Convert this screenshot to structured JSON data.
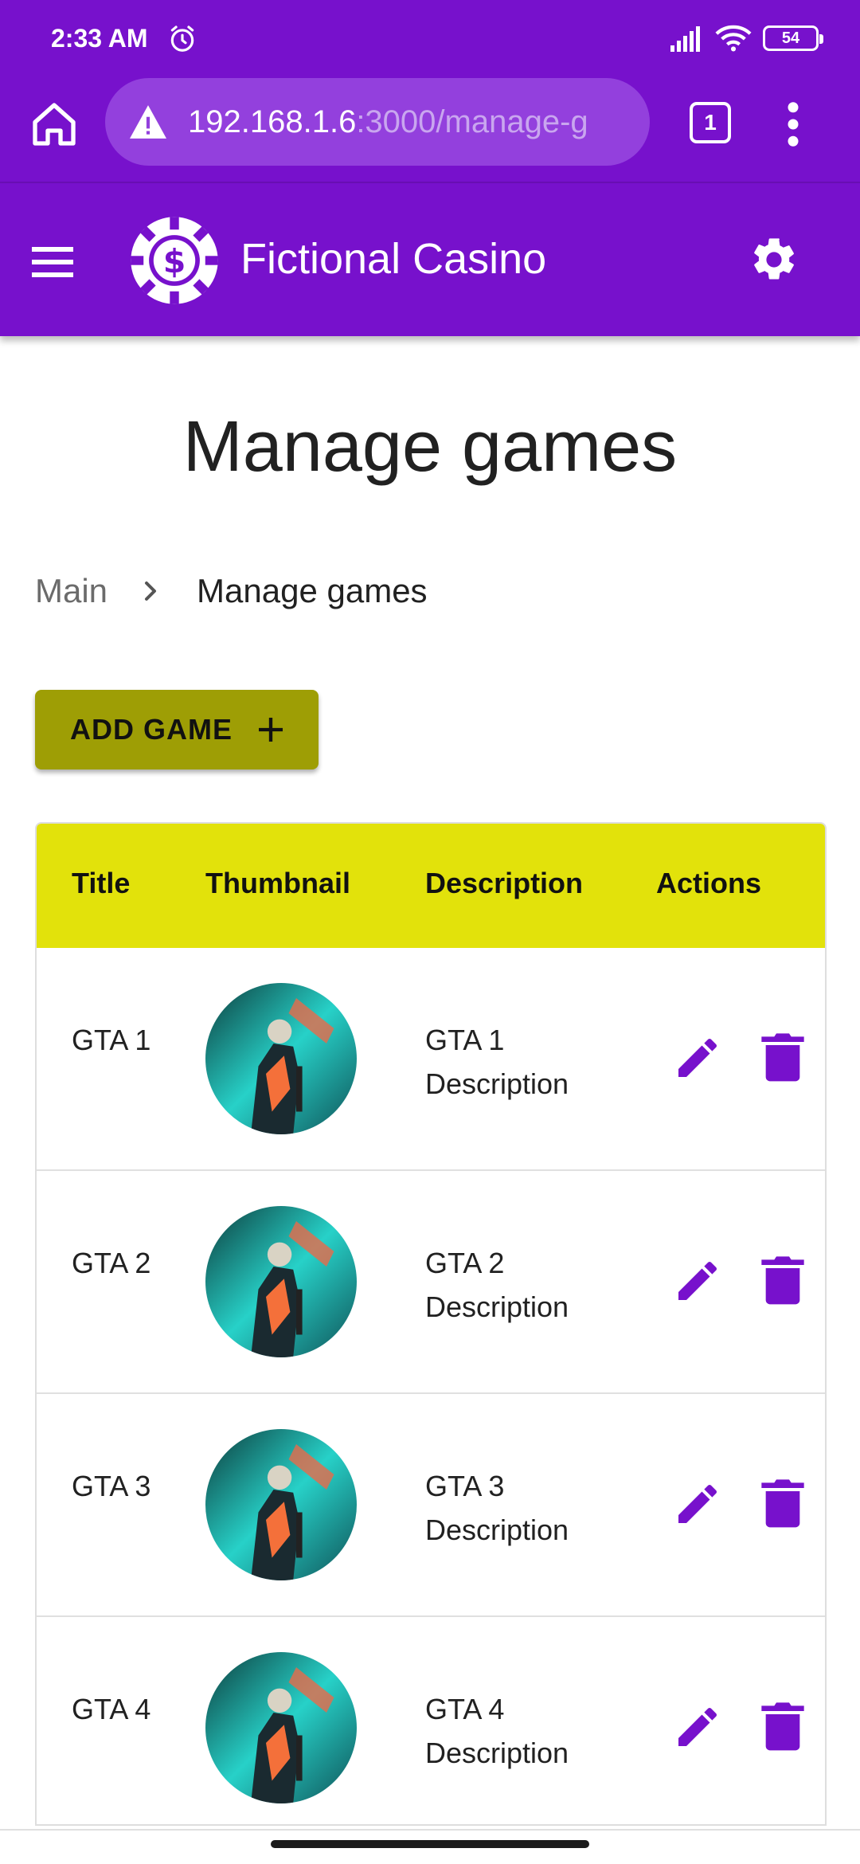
{
  "status_bar": {
    "time": "2:33 AM",
    "battery": "54"
  },
  "browser": {
    "url_host": "192.168.1.6",
    "url_path": ":3000/manage-g",
    "tab_count": "1"
  },
  "app_bar": {
    "title": "Fictional Casino"
  },
  "page": {
    "title": "Manage games",
    "breadcrumb": {
      "main": "Main",
      "current": "Manage games"
    },
    "add_button_label": "ADD GAME"
  },
  "table": {
    "headers": {
      "title": "Title",
      "thumbnail": "Thumbnail",
      "description": "Description",
      "actions": "Actions"
    },
    "rows": [
      {
        "title": "GTA 1",
        "description": "GTA 1 Description"
      },
      {
        "title": "GTA 2",
        "description": "GTA 2 Description"
      },
      {
        "title": "GTA 3",
        "description": "GTA 3 Description"
      },
      {
        "title": "GTA 4",
        "description": "GTA 4 Description"
      }
    ]
  },
  "colors": {
    "primary": "#7711cc",
    "accent_button": "#9e9e05",
    "table_header": "#e2e20b",
    "icon_action": "#7711cc"
  }
}
